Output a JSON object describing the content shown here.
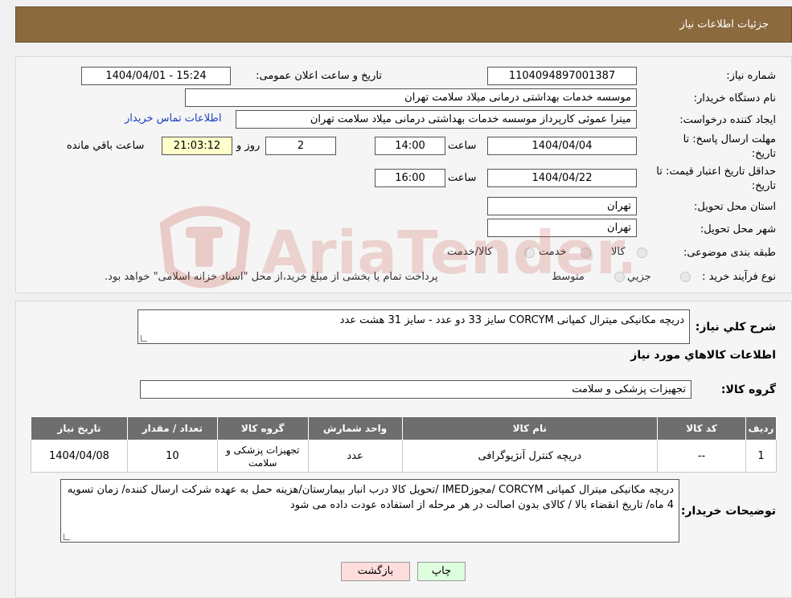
{
  "header": {
    "title": "جزئیات اطلاعات نیاز"
  },
  "form": {
    "need_number_label": "شماره نیاز:",
    "need_number": "1104094897001387",
    "announce_label": "تاریخ و ساعت اعلان عمومی:",
    "announce_value": "1404/04/01 - 15:24",
    "buyer_org_label": "نام دستگاه خریدار:",
    "buyer_org": "موسسه خدمات بهداشتی درمانی میلاد سلامت تهران",
    "creator_label": "ایجاد کننده درخواست:",
    "creator": "میترا عموئی کارپرداز موسسه خدمات بهداشتی درمانی میلاد سلامت تهران",
    "contact_link": "اطلاعات تماس خریدار",
    "deadline_label_1": "مهلت ارسال پاسخ: تا",
    "deadline_label_2": "تاریخ:",
    "deadline_date": "1404/04/04",
    "time_label": "ساعت",
    "deadline_time": "14:00",
    "days_value": "2",
    "days_label": "روز و",
    "remaining_time": "21:03:12",
    "remaining_label": "ساعت باقي مانده",
    "validity_label_1": "حداقل تاریخ اعتبار قیمت: تا",
    "validity_label_2": "تاریخ:",
    "validity_date": "1404/04/22",
    "validity_time": "16:00",
    "province_label": "استان محل تحویل:",
    "province": "تهران",
    "city_label": "شهر محل تحویل:",
    "city": "تهران",
    "category_label": "طبقه بندی موضوعی:",
    "category_options": [
      "کالا",
      "خدمت",
      "کالا/خدمت"
    ],
    "process_label": "نوع فرآیند خرید :",
    "process_options": [
      "جزيي",
      "متوسط"
    ],
    "process_note": "پرداخت تمام یا بخشی از مبلغ خرید،از محل \"اسناد خزانه اسلامی\" خواهد بود."
  },
  "summary": {
    "label": "شرح کلي نياز:",
    "text": "دریچه مکانیکی میترال کمپانی CORCYM  سایز 33 دو عدد - سایز 31 هشت عدد"
  },
  "goods": {
    "section_title": "اطلاعات کالاهاي مورد نياز",
    "group_label": "گروه کالا:",
    "group_value": "تجهیزات پزشکی و سلامت",
    "columns": [
      "ردیف",
      "کد کالا",
      "نام کالا",
      "واحد شمارش",
      "گروه کالا",
      "تعداد / مقدار",
      "تاریخ نیاز"
    ],
    "rows": [
      {
        "row": "1",
        "code": "--",
        "name": "دریچه کنترل آنژیوگرافی",
        "unit": "عدد",
        "group": "تجهیزات پزشکی و سلامت",
        "qty": "10",
        "date": "1404/04/08"
      }
    ]
  },
  "buyer_notes": {
    "label": "توضیحات خریدار:",
    "text": "دریچه مکانیکی میترال کمپانی CORCYM /مجوزIMED /تحویل کالا درب انبار بیمارستان/هزینه حمل به عهده شرکت ارسال کننده/ زمان تسویه 4 ماه/ تاریخ انقضاء بالا / کالای بدون اصالت در هر مرحله از استفاده عودت داده می شود"
  },
  "buttons": {
    "print": "چاپ",
    "back": "بازگشت"
  },
  "watermark_text": "AriaTender.neT",
  "colors": {
    "header": "#8b6a3e",
    "print_bg": "#ddffdd",
    "back_bg": "#ffdddd",
    "link": "#1a3fbf"
  }
}
